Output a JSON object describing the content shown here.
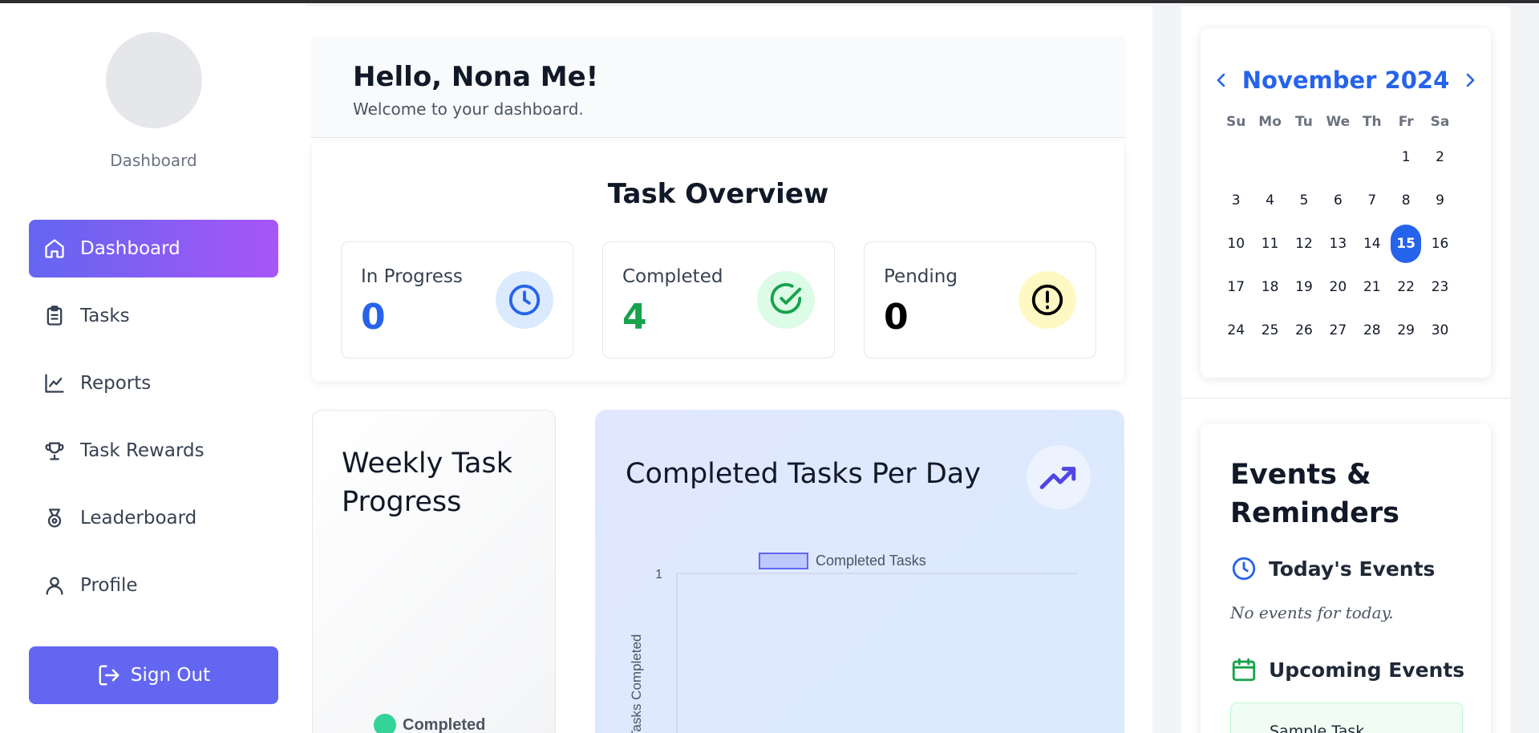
{
  "profile": {
    "caption": "Dashboard"
  },
  "nav": {
    "items": [
      {
        "label": "Dashboard",
        "icon": "home-icon",
        "active": true
      },
      {
        "label": "Tasks",
        "icon": "clipboard-icon"
      },
      {
        "label": "Reports",
        "icon": "line-chart-icon"
      },
      {
        "label": "Task Rewards",
        "icon": "trophy-icon"
      },
      {
        "label": "Leaderboard",
        "icon": "medal-icon"
      },
      {
        "label": "Profile",
        "icon": "user-icon"
      }
    ],
    "signout_label": "Sign Out"
  },
  "greeting": {
    "title": "Hello, Nona Me!",
    "subtitle": "Welcome to your dashboard."
  },
  "overview": {
    "title": "Task Overview",
    "stats": [
      {
        "label": "In Progress",
        "value": "0",
        "color": "#2563eb",
        "icon": "clock-icon"
      },
      {
        "label": "Completed",
        "value": "4",
        "color": "#16a34a",
        "icon": "check-circle-icon"
      },
      {
        "label": "Pending",
        "value": "0",
        "color": "#000000",
        "icon": "alert-circle-icon"
      }
    ]
  },
  "weekly": {
    "title": "Weekly Task Progress",
    "legend_label": "Completed"
  },
  "perday": {
    "title": "Completed Tasks Per Day"
  },
  "chart_data": {
    "type": "bar",
    "title": "",
    "legend": [
      "Completed Tasks"
    ],
    "ylabel": "Tasks Completed",
    "yticks": [
      "1"
    ],
    "series": [
      {
        "name": "Completed Tasks",
        "values": []
      }
    ]
  },
  "calendar": {
    "title": "November 2024",
    "days_of_week": [
      "Su",
      "Mo",
      "Tu",
      "We",
      "Th",
      "Fr",
      "Sa"
    ],
    "first_weekday": 5,
    "num_days": 30,
    "today": 15
  },
  "events": {
    "title": "Events & Reminders",
    "today_title": "Today's Events",
    "no_events": "No events for today.",
    "upcoming_title": "Upcoming Events",
    "upcoming_items": [
      "Sample Task"
    ]
  },
  "colors": {
    "accent": "#6366f1",
    "accent2": "#a855f7",
    "blue": "#2563eb",
    "green": "#16a34a"
  }
}
